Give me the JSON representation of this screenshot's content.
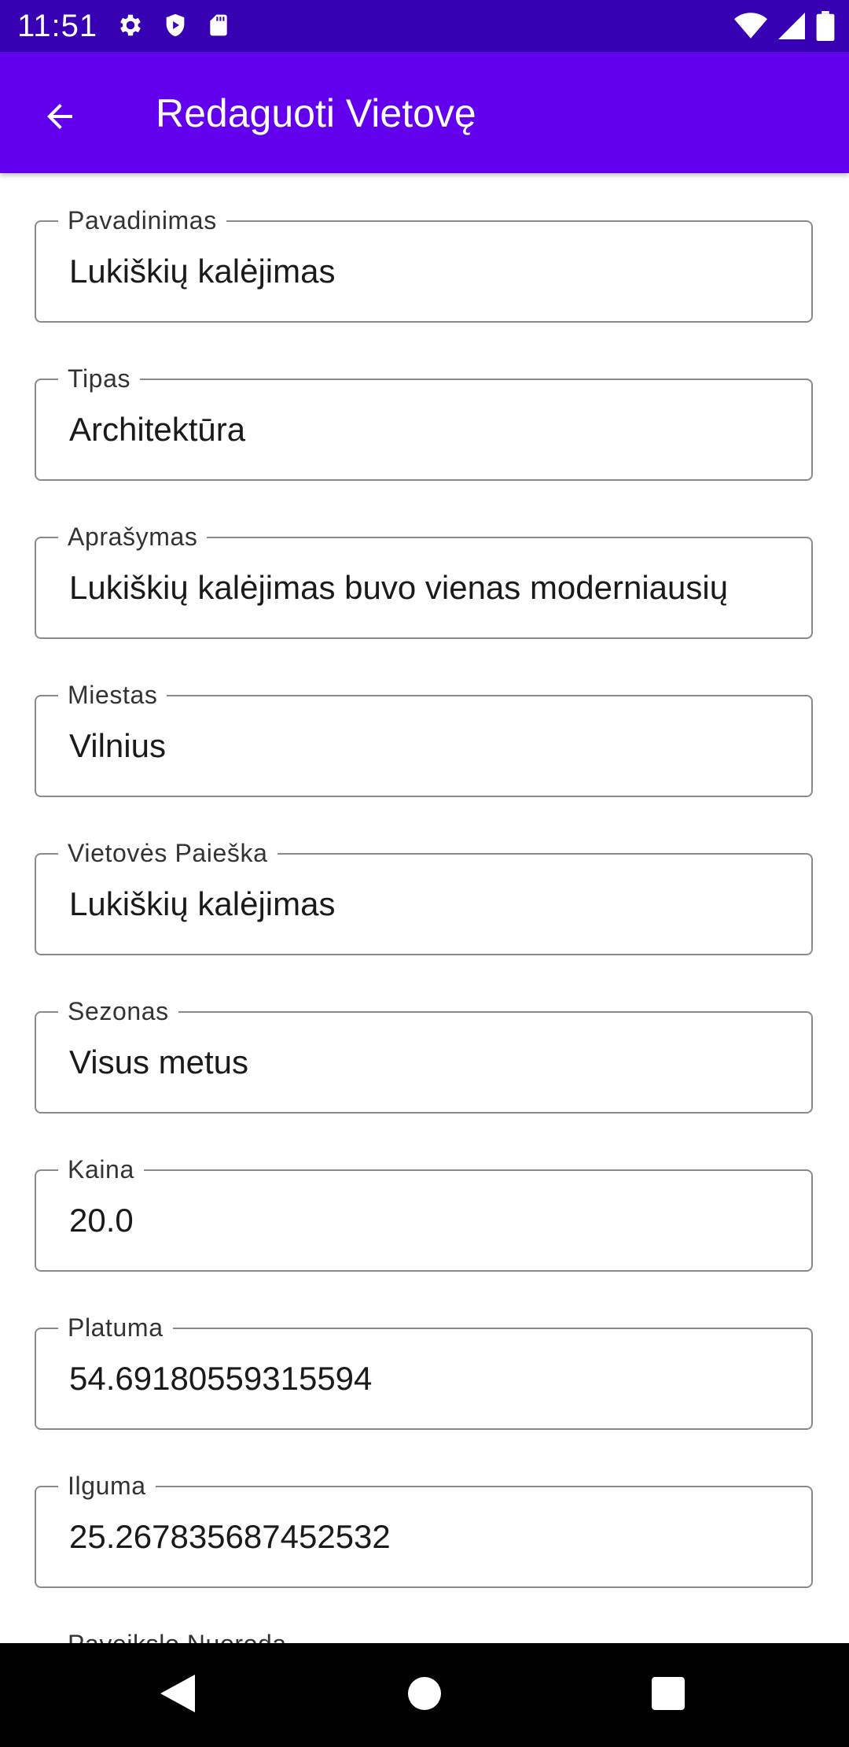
{
  "status_bar": {
    "time": "11:51",
    "left_icons": [
      "gear-icon",
      "shield-icon",
      "sd-card-icon"
    ],
    "right_icons": [
      "wifi-icon",
      "signal-icon",
      "battery-icon"
    ]
  },
  "app_bar": {
    "title": "Redaguoti Vietovę",
    "back_icon": "arrow-back-icon",
    "color": "#6200EE",
    "status_color": "#3700B3"
  },
  "form": {
    "fields": [
      {
        "label": "Pavadinimas",
        "value": "Lukiškių kalėjimas"
      },
      {
        "label": "Tipas",
        "value": "Architektūra"
      },
      {
        "label": "Aprašymas",
        "value": "Lukiškių kalėjimas buvo vienas moderniausių"
      },
      {
        "label": "Miestas",
        "value": "Vilnius"
      },
      {
        "label": "Vietovės Paieška",
        "value": "Lukiškių kalėjimas"
      },
      {
        "label": "Sezonas",
        "value": "Visus metus"
      },
      {
        "label": "Kaina",
        "value": "20.0"
      },
      {
        "label": "Platuma",
        "value": "54.69180559315594"
      },
      {
        "label": "Ilguma",
        "value": "25.267835687452532"
      },
      {
        "label": "Paveikslo Nuoroda",
        "value": ""
      }
    ]
  },
  "nav_bar": {
    "icons": [
      "back-triangle-icon",
      "home-circle-icon",
      "recents-square-icon"
    ]
  }
}
